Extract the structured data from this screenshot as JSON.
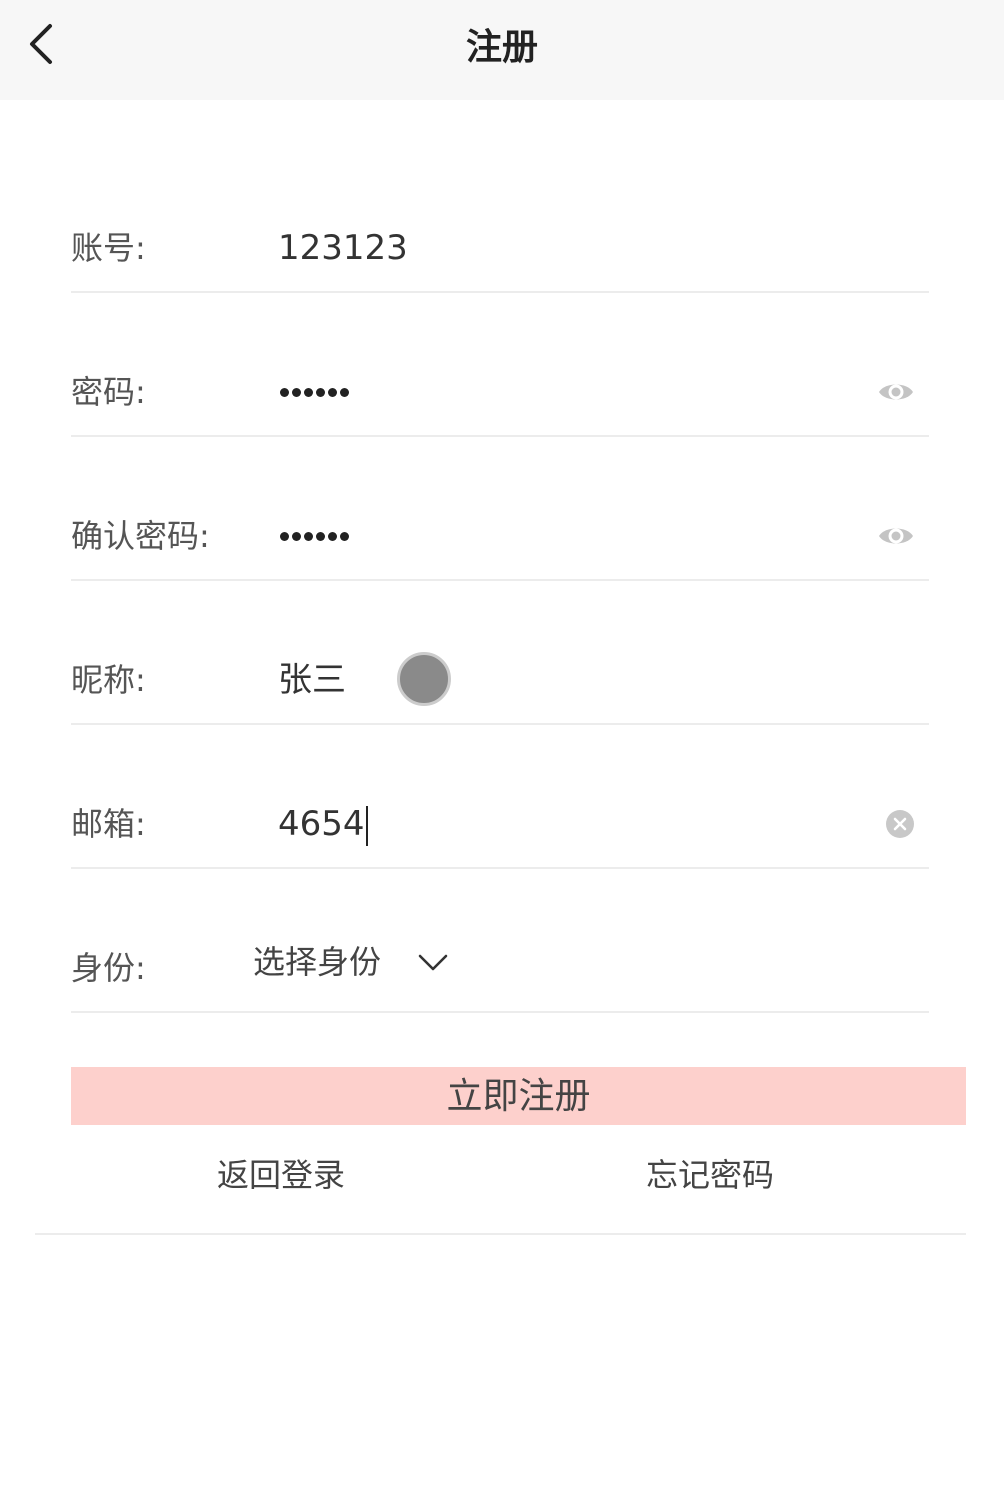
{
  "nav": {
    "title": "注册"
  },
  "form": {
    "account": {
      "label": "账号:",
      "value": "123123"
    },
    "password": {
      "label": "密码:",
      "mask_length": 6
    },
    "confirm_password": {
      "label": "确认密码:",
      "mask_length": 6
    },
    "nickname": {
      "label": "昵称:",
      "value": "张三"
    },
    "email": {
      "label": "邮箱:",
      "value": "4654"
    },
    "identity": {
      "label": "身份:",
      "selected": "选择身份"
    }
  },
  "actions": {
    "register_label": "立即注册",
    "back_to_login_label": "返回登录",
    "forgot_password_label": "忘记密码"
  },
  "colors": {
    "nav_background": "#f7f7f7",
    "register_button_background": "#fdd0cc",
    "divider": "#ececec"
  },
  "icons": {
    "back": "chevron-left-icon",
    "password_toggle": "eye-icon",
    "email_clear": "clear-icon",
    "identity_dropdown": "chevron-down-icon"
  }
}
